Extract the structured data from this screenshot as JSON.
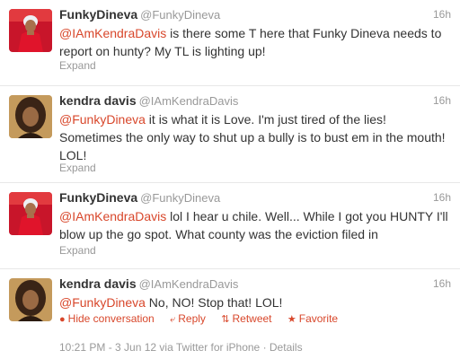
{
  "colors": {
    "mention": "#d8472b",
    "muted": "#999999",
    "text": "#333333",
    "divider": "#e8e8e8"
  },
  "tweets": [
    {
      "name": "FunkyDineva",
      "handle": "@FunkyDineva",
      "time": "16h",
      "mention": "@IAmKendraDavis",
      "text": " is there some T here that Funky Dineva needs to report on hunty? My TL is lighting up!",
      "expand": "Expand",
      "avatar_icon": "avatar-red-dress"
    },
    {
      "name": "kendra davis",
      "handle": "@IAmKendraDavis",
      "time": "16h",
      "mention": "@FunkyDineva",
      "text": " it is what it is Love. I'm just tired of the lies! Sometimes the only way to shut up a bully is to bust em in the mouth! LOL!",
      "expand": "Expand",
      "avatar_icon": "avatar-woman-portrait"
    },
    {
      "name": "FunkyDineva",
      "handle": "@FunkyDineva",
      "time": "16h",
      "mention": "@IAmKendraDavis",
      "text": " lol I hear u chile. Well... While I got you HUNTY I'll blow up the go spot. What county was the eviction filed in",
      "expand": "Expand",
      "avatar_icon": "avatar-red-dress"
    },
    {
      "name": "kendra davis",
      "handle": "@IAmKendraDavis",
      "time": "16h",
      "mention": "@FunkyDineva",
      "text": " No, NO! Stop that! LOL!",
      "avatar_icon": "avatar-woman-portrait",
      "actions": {
        "hide": "Hide conversation",
        "reply": "Reply",
        "retweet": "Retweet",
        "favorite": "Favorite"
      },
      "meta": "10:21 PM - 3 Jun 12 via Twitter for iPhone · Details"
    }
  ]
}
